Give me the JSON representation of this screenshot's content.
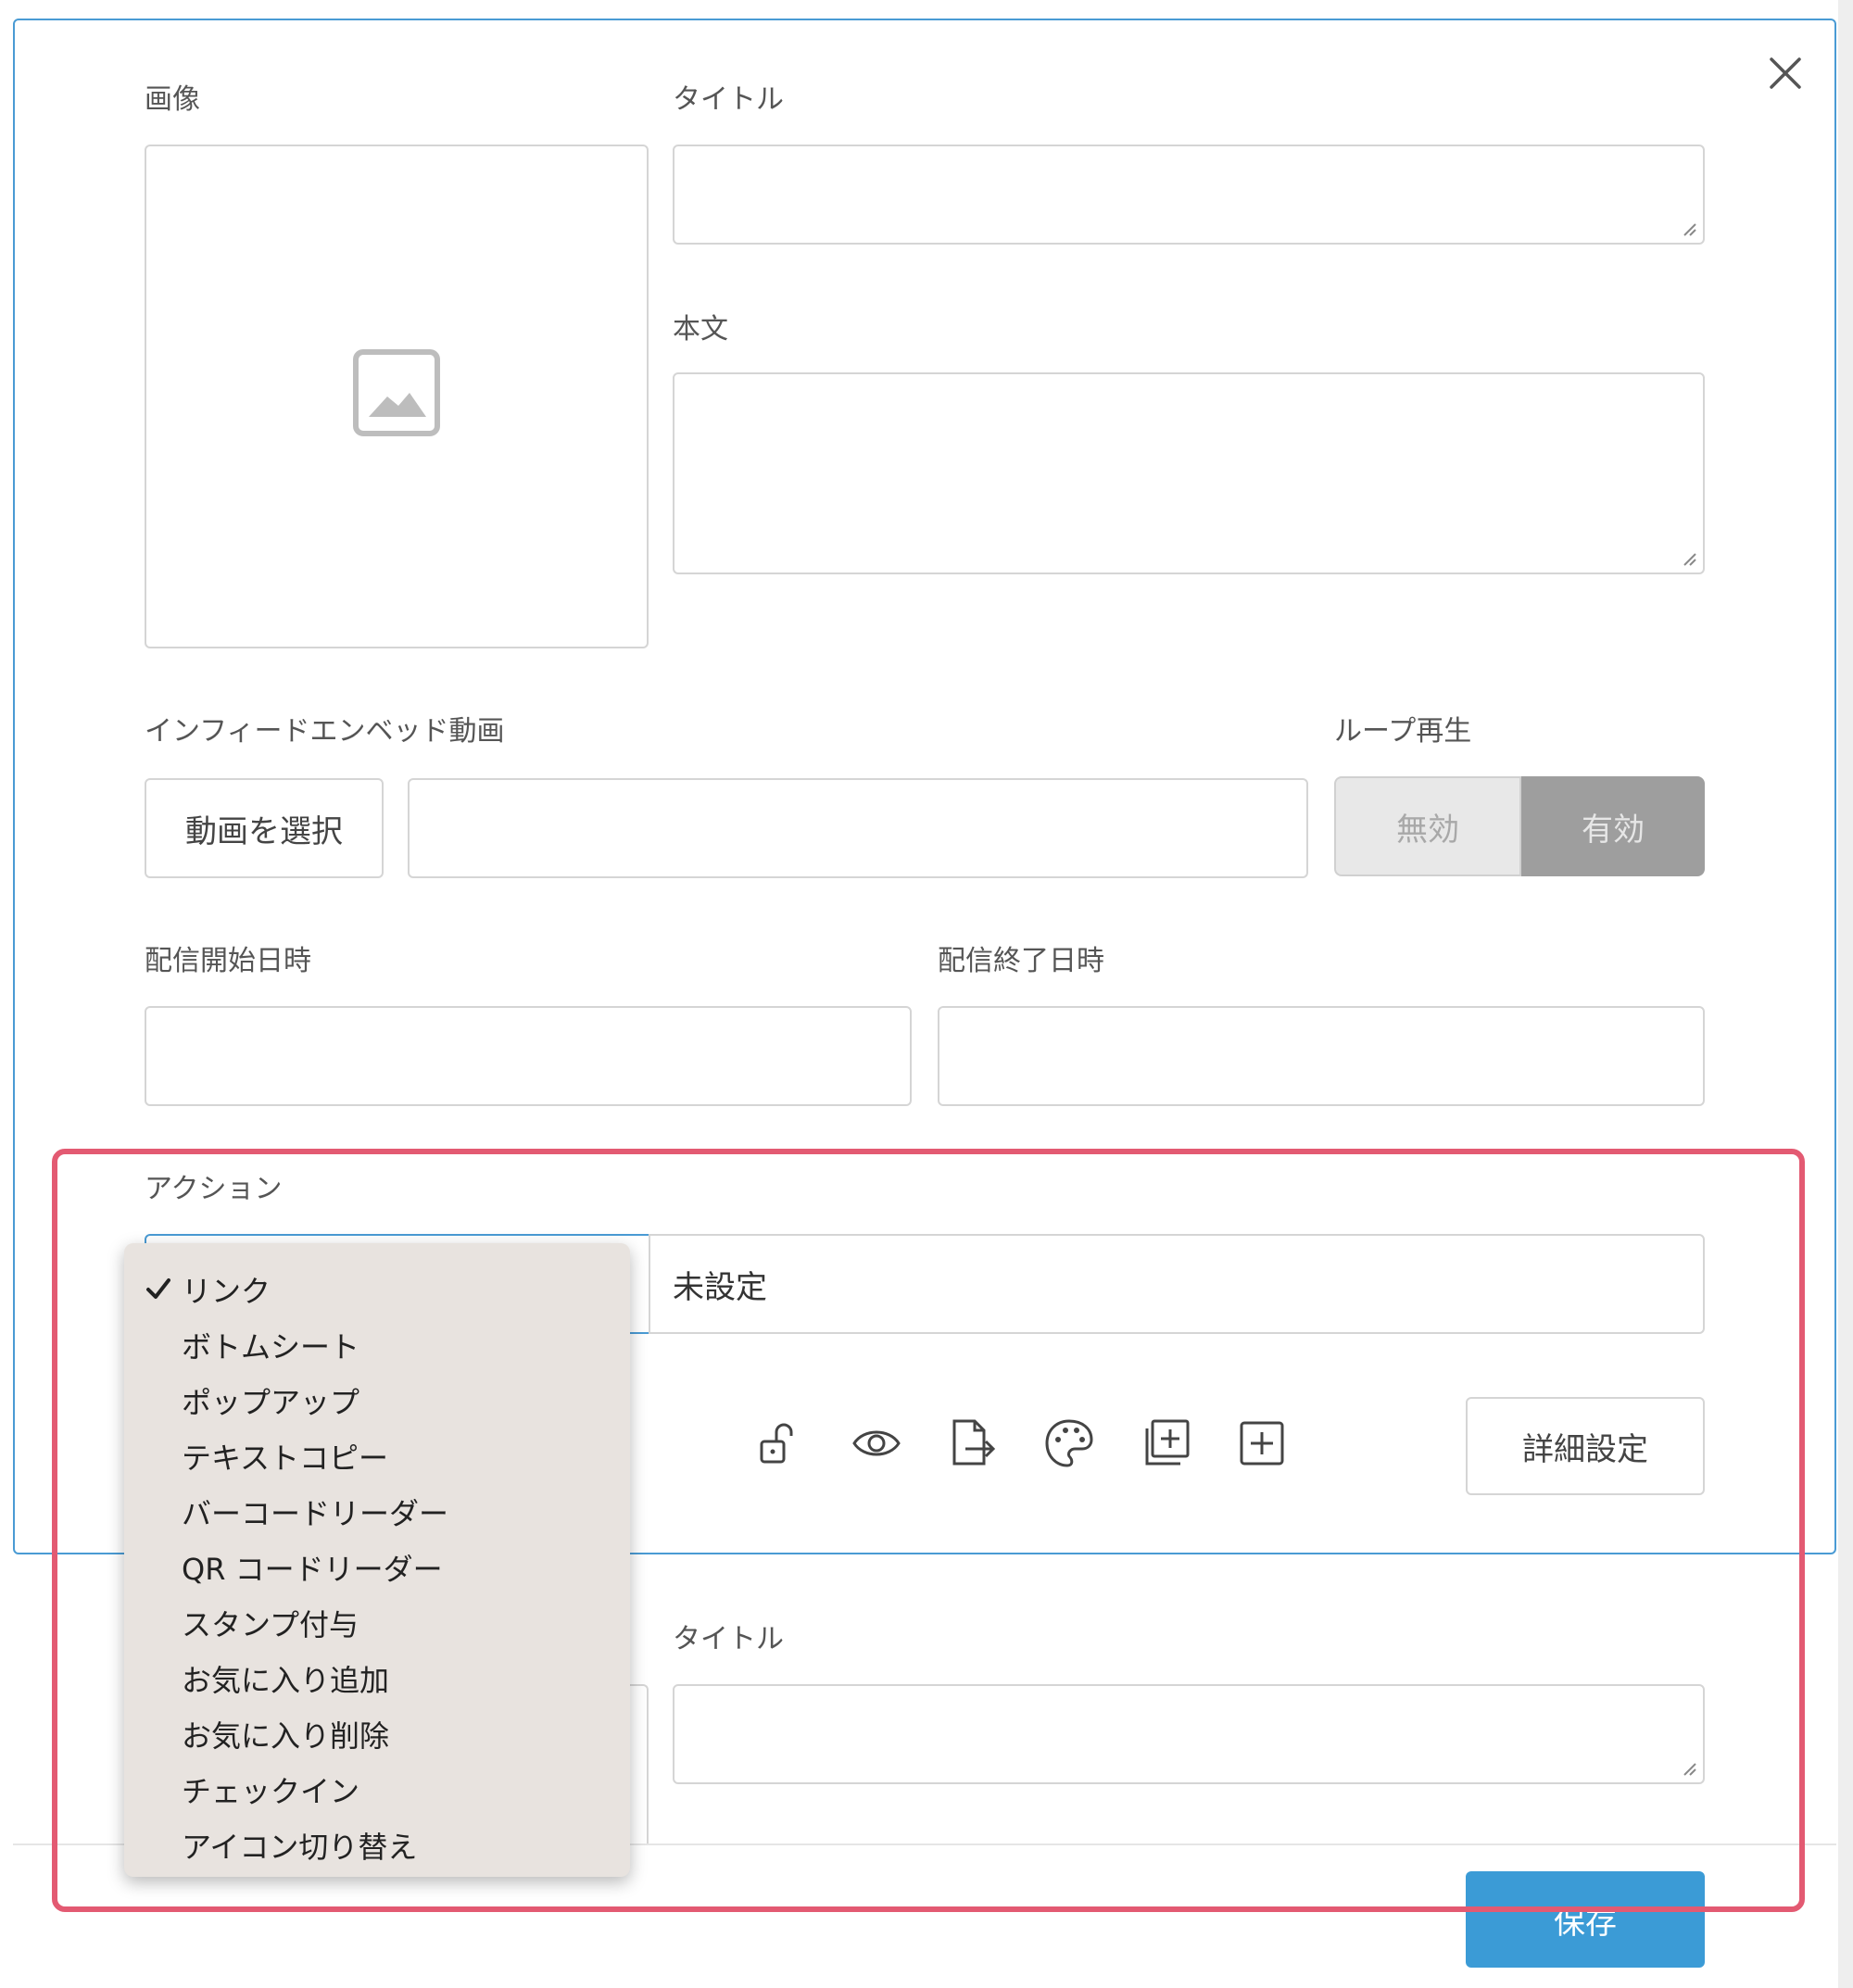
{
  "form": {
    "image_label": "画像",
    "title_label": "タイトル",
    "body_label": "本文",
    "video_label": "インフィードエンベッド動画",
    "video_select_button": "動画を選択",
    "loop_label": "ループ再生",
    "loop_options": [
      "無効",
      "有効"
    ],
    "start_label": "配信開始日時",
    "end_label": "配信終了日時",
    "action_label": "アクション",
    "action_value": "未設定",
    "details_button": "詳細設定",
    "title_label_2": "タイトル",
    "save_button": "保存"
  },
  "dropdown": {
    "selected": "リンク",
    "items": [
      "リンク",
      "ボトムシート",
      "ポップアップ",
      "テキストコピー",
      "バーコードリーダー",
      "QR コードリーダー",
      "スタンプ付与",
      "お気に入り追加",
      "お気に入り削除",
      "チェックイン",
      "アイコン切り替え"
    ]
  },
  "toolbar_icons": [
    "unlock-icon",
    "eye-icon",
    "file-export-icon",
    "palette-icon",
    "copy-add-icon",
    "add-square-icon"
  ],
  "colors": {
    "accent": "#3b9bd6",
    "highlight": "#e35a72",
    "toggle_active": "#9e9e9e"
  }
}
